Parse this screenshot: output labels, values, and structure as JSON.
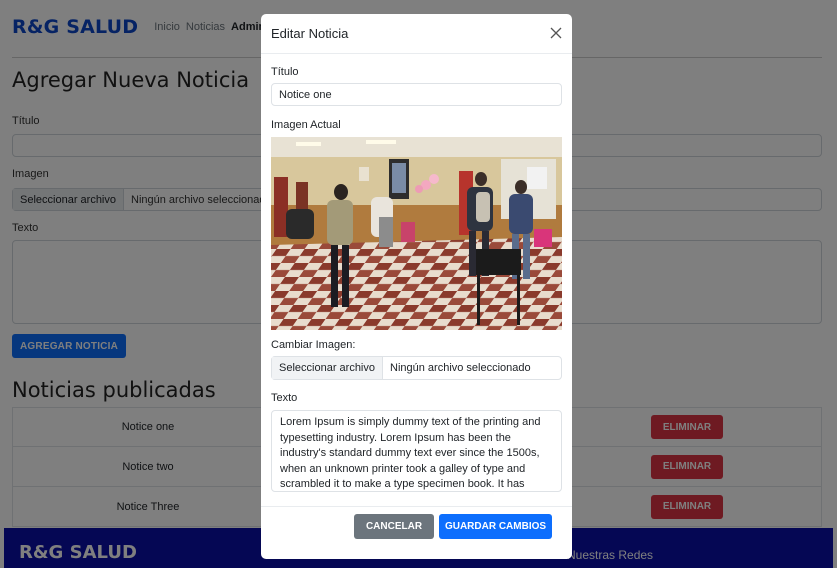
{
  "nav": {
    "brand": "R&G SALUD",
    "links": [
      "Inicio",
      "Noticias",
      "Admin"
    ]
  },
  "form": {
    "heading": "Agregar Nueva Noticia",
    "title_label": "Título",
    "image_label": "Imagen",
    "file_button": "Seleccionar archivo",
    "file_status": "Ningún archivo seleccionado",
    "text_label": "Texto",
    "submit": "AGREGAR NOTICIA"
  },
  "published": {
    "heading": "Noticias publicadas",
    "rows": [
      {
        "title": "Notice one",
        "delete": "ELIMINAR"
      },
      {
        "title": "Notice two",
        "delete": "ELIMINAR"
      },
      {
        "title": "Notice Three",
        "delete": "ELIMINAR"
      }
    ]
  },
  "footer": {
    "brand": "R&G SALUD",
    "social": "Nuestras Redes"
  },
  "modal": {
    "title": "Editar Noticia",
    "title_label": "Título",
    "title_value": "Notice one",
    "current_image_label": "Imagen Actual",
    "change_image_label": "Cambiar Imagen:",
    "file_button": "Seleccionar archivo",
    "file_status": "Ningún archivo seleccionado",
    "text_label": "Texto",
    "text_value": "Lorem Ipsum is simply dummy text of the printing and typesetting industry. Lorem Ipsum has been the industry's standard dummy text ever since the 1500s, when an unknown printer took a galley of type and scrambled it to make a type specimen book. It has",
    "cancel": "CANCELAR",
    "save": "GUARDAR CAMBIOS"
  },
  "colors": {
    "brand": "#0d47c9",
    "primary": "#0d6efd",
    "danger": "#dc3545",
    "secondary": "#6c757d",
    "footer": "#0b0fa8"
  }
}
